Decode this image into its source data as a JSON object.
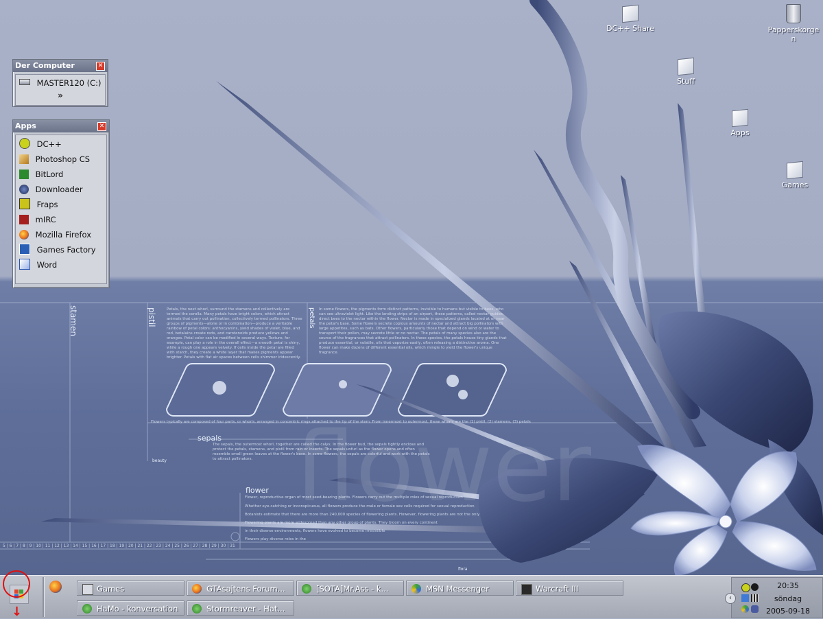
{
  "desktop_icons": [
    {
      "label": "DC++ Share",
      "icon": "folder-icon"
    },
    {
      "label": "Papperskorgen",
      "icon": "recycle-bin-icon"
    },
    {
      "label": "Stuff",
      "icon": "folder-icon"
    },
    {
      "label": "Apps",
      "icon": "folder-icon"
    },
    {
      "label": "Games",
      "icon": "folder-icon"
    }
  ],
  "computer_widget": {
    "title": "Der Computer",
    "close": "✕",
    "drive": "MASTER120 (C:)",
    "more": "»"
  },
  "apps_widget": {
    "title": "Apps",
    "close": "✕",
    "items": [
      {
        "label": "DC++",
        "icon": "dcpp-icon",
        "color": "#c9d21c"
      },
      {
        "label": "Photoshop CS",
        "icon": "photoshop-icon",
        "color": "#d9a83a"
      },
      {
        "label": "BitLord",
        "icon": "bitlord-icon",
        "color": "#2e8a2e"
      },
      {
        "label": "Downloader",
        "icon": "downloader-icon",
        "color": "#2b3a66"
      },
      {
        "label": "Fraps",
        "icon": "fraps-icon",
        "color": "#c9c31a"
      },
      {
        "label": "mIRC",
        "icon": "mirc-icon",
        "color": "#a51f1f"
      },
      {
        "label": "Mozilla Firefox",
        "icon": "firefox-icon",
        "color": "#e8701c"
      },
      {
        "label": "Games Factory",
        "icon": "games-factory-icon",
        "color": "#2a5fb5"
      },
      {
        "label": "Word",
        "icon": "word-icon",
        "color": "#2a55b0"
      }
    ]
  },
  "wallpaper": {
    "stamen": "stamen",
    "pistil": "pistil",
    "petals": "petals",
    "sepals": "sepals",
    "flower": "flower",
    "flower_big": "flower",
    "beauty": "beauty",
    "flora": "flora",
    "petals_text": "Petals, the next whorl, surround the stamens and collectively are termed the corolla. Many petals have bright colors, which attract animals that carry out pollination, collectively termed pollinators. Three groups of pigments—alone or in combination—produce a veritable rainbow of petal colors: anthocyanins, yield shades of violet, blue, and red, betalains create reds, and carotenoids produce yellows and oranges. Petal color can be modified in several ways. Texture, for example, can play a role in the overall effect—a smooth petal is shiny, while a rough one appears velvety. If cells inside the petal are filled with starch, they create a white layer that makes pigments appear brighter. Petals with flat air spaces between cells shimmer iridescently.",
    "pigments_text": "In some flowers, the pigments form distinct patterns, invisible to humans but visible to bees, who can see ultraviolet light. Like the landing strips of an airport, these patterns, called nectar guides, direct bees to the nectar within the flower. Nectar is made in specialized glands located at or near the petal's base. Some flowers secrete copious amounts of nectar and attract big pollinators with large appetites, such as bats. Other flowers, particularly those that depend on wind or water to transport their pollen, may secrete little or no nectar. The petals of many species also are the source of the fragrances that attract pollinators. In these species, the petals house tiny glands that produce essential, or volatile, oils that vaporize easily, often releasing a distinctive aroma. One flower can make dozens of different essential oils, which mingle to yield the flower's unique fragrance.",
    "parts_text": "Flowers typically are composed of four parts, or whorls, arranged in concentric rings attached to the tip of the stem: From innermost to outermost, these whorls are the (1) pistil, (2) stamens, (3) petals",
    "sepals_text": "The sepals, the outermost whorl, together are called the calyx. In the flower bud, the sepals tightly enclose and protect the petals, stamens, and pistil from rain or insects. The sepals unfurl as the flower opens and often resemble small green leaves at the flower's base. In some flowers, the sepals are colorful and work with the petals to attract pollinators.",
    "flower_text_1": "Flower, reproductive organ of most seed-bearing plants. Flowers carry out the multiple roles of sexual reproduction",
    "flower_text_2": "Whether eye-catching or inconspicuous, all flowers produce the male or female sex cells required for sexual reproduction",
    "flower_text_3": "Botanists estimate that there are more than 240,000 species of flowering plants. However, flowering plants are not the only",
    "flower_text_4": "Flowering plants are more widespread than any other group of plants. They bloom on every continent",
    "flower_text_5": "in their diverse environments, flowers have evolved to become irresistible",
    "flower_text_6": "Flowers play diverse roles in the",
    "ruler": "5 | 6 | 7 | 8 | 9 | 10 | 11 | 12 | 13 | 14 | 15 | 16 | 17 | 18 | 19 | 20 | 21 | 22 | 23 | 24 | 25 | 26 | 27 | 28 | 29 | 30 | 31 | 32"
  },
  "taskbar": {
    "start_icon": "windows-logo-icon",
    "quick_launch": [
      {
        "icon": "firefox-icon"
      }
    ],
    "tasks": [
      {
        "label": "Games",
        "icon": "folder-icon"
      },
      {
        "label": "GTAsajtens Forum...",
        "icon": "firefox-icon"
      },
      {
        "label": "[SOTA]Mr.Ass - k...",
        "icon": "msn-chat-icon"
      },
      {
        "label": "MSN Messenger",
        "icon": "msn-messenger-icon"
      },
      {
        "label": "Warcraft III",
        "icon": "warcraft-icon"
      },
      {
        "label": "HaMo - konversation",
        "icon": "msn-chat-icon"
      },
      {
        "label": "Stormreaver - Hat...",
        "icon": "msn-chat-icon"
      }
    ],
    "tray": {
      "collapse": "‹",
      "time": "20:35",
      "day": "söndag",
      "date": "2005-09-18"
    }
  },
  "colors": {
    "accent_red": "#e01010",
    "wallpaper_top": "#a9b1c8",
    "wallpaper_band": "#5f6f9a",
    "taskbar": "#b4b8c2"
  }
}
